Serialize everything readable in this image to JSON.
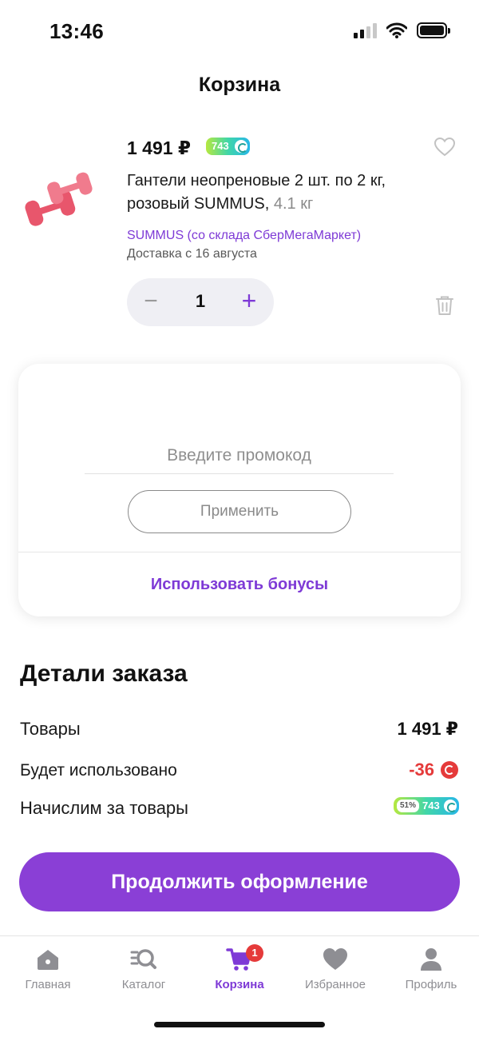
{
  "status_bar": {
    "time": "13:46"
  },
  "header": {
    "title": "Корзина"
  },
  "cart_item": {
    "price": "1 491 ₽",
    "bonus_amount": "743",
    "name": "Гантели неопреновые 2 шт. по 2 кг, розовый SUMMUS,",
    "weight": "4.1 кг",
    "seller": "SUMMUS (со склада СберМегаМаркет)",
    "delivery": "Доставка с 16 августа",
    "quantity": "1",
    "minus_symbol": "−",
    "plus_symbol": "+",
    "icons": [
      "heart-icon",
      "trash-icon"
    ],
    "image_colors": {
      "dumbbell": "#e8566c"
    }
  },
  "promo": {
    "placeholder": "Введите промокод",
    "apply_label": "Применить",
    "bonus_link": "Использовать бонусы"
  },
  "order_details": {
    "title": "Детали заказа",
    "goods_label": "Товары",
    "goods_value": "1 491 ₽",
    "used_label": "Будет использовано",
    "used_value": "-36",
    "earn_label": "Начислим за товары",
    "earn_percent": "51%",
    "earn_value": "743"
  },
  "checkout": {
    "label": "Продолжить оформление"
  },
  "tabbar": {
    "items": [
      {
        "label": "Главная",
        "icon": "home-icon"
      },
      {
        "label": "Каталог",
        "icon": "catalog-search-icon"
      },
      {
        "label": "Корзина",
        "icon": "cart-icon",
        "badge": "1",
        "active": true
      },
      {
        "label": "Избранное",
        "icon": "heart-icon"
      },
      {
        "label": "Профиль",
        "icon": "profile-icon"
      }
    ]
  },
  "colors": {
    "accent": "#7e3ad6",
    "button": "#8a3fd6",
    "danger": "#e53a3a"
  }
}
